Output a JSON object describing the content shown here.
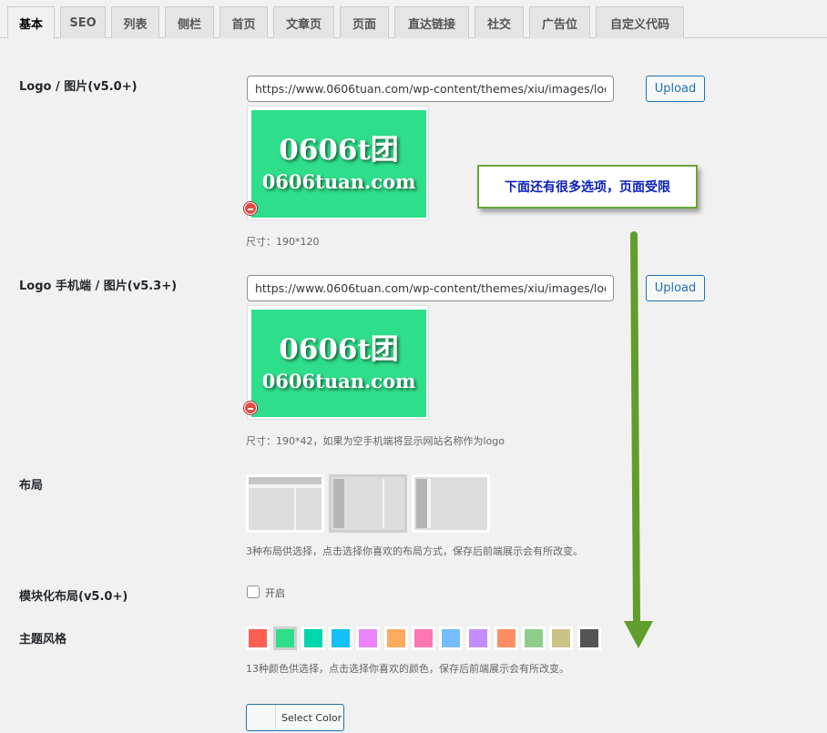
{
  "tabs": [
    {
      "label": "基本",
      "active": true
    },
    {
      "label": "SEO"
    },
    {
      "label": "列表"
    },
    {
      "label": "侧栏"
    },
    {
      "label": "首页"
    },
    {
      "label": "文章页"
    },
    {
      "label": "页面"
    },
    {
      "label": "直达链接"
    },
    {
      "label": "社交"
    },
    {
      "label": "广告位"
    },
    {
      "label": "自定义代码"
    }
  ],
  "logo": {
    "label": "Logo / 图片(v5.0+)",
    "url": "https://www.0606tuan.com/wp-content/themes/xiu/images/log",
    "upload_label": "Upload",
    "image_line1": "0606t团",
    "image_line2": "0606tuan.com",
    "hint": "尺寸：190*120"
  },
  "logo_mobile": {
    "label": "Logo 手机端 / 图片(v5.3+)",
    "url": "https://www.0606tuan.com/wp-content/themes/xiu/images/log",
    "upload_label": "Upload",
    "image_line1": "0606t团",
    "image_line2": "0606tuan.com",
    "hint": "尺寸：190*42，如果为空手机端将显示网站名称作为logo"
  },
  "callout": {
    "text": "下面还有很多选项，页面受限"
  },
  "layout": {
    "label": "布局",
    "selected_index": 1,
    "hint": "3种布局供选择，点击选择你喜欢的布局方式，保存后前端展示会有所改变。"
  },
  "modular": {
    "label": "模块化布局(v5.0+)",
    "option_label": "开启",
    "checked": false
  },
  "theme": {
    "label": "主题风格",
    "colors": [
      "#ff5e52",
      "#2ede8b",
      "#00d6ac",
      "#16c0f8",
      "#ea84ff",
      "#fdac5f",
      "#fd77b2",
      "#76bdff",
      "#c38cff",
      "#ff8d64",
      "#8dce8d",
      "#c9c387",
      "#555555"
    ],
    "selected_index": 1,
    "hint": "13种颜色供选择，点击选择你喜欢的颜色，保存后前端展示会有所改变。",
    "select_color_label": "Select Color"
  },
  "accent_colors": {
    "arrow": "#5f9e2a",
    "callout_text": "#0b1fb8",
    "link": "#2271b1"
  }
}
